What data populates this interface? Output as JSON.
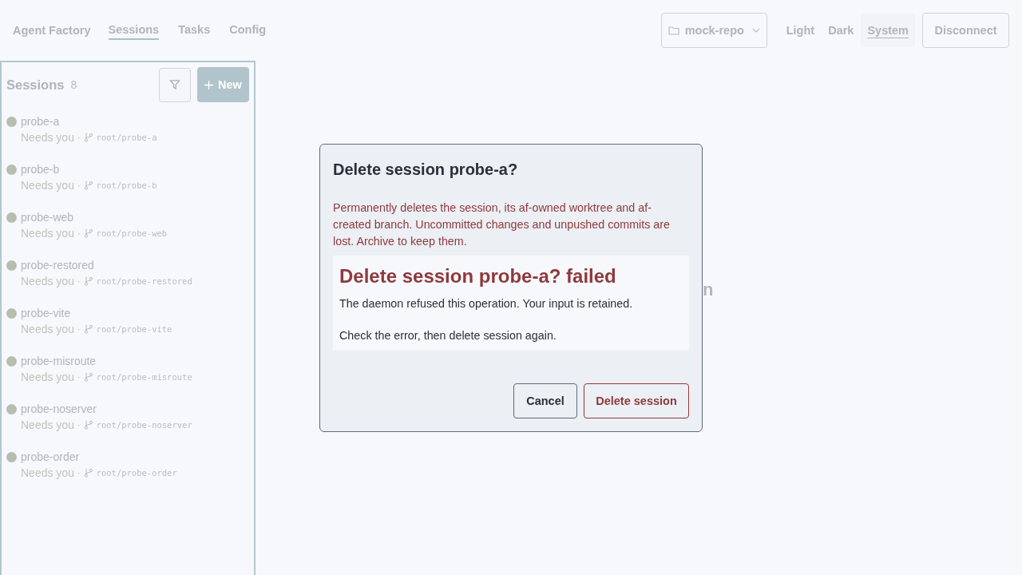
{
  "nav": {
    "brand": "Agent Factory",
    "tabs": [
      {
        "label": "Sessions",
        "selected": true
      },
      {
        "label": "Tasks",
        "selected": false
      },
      {
        "label": "Config",
        "selected": false
      }
    ]
  },
  "repo_select": {
    "value": "mock-repo"
  },
  "theme": [
    {
      "label": "Light",
      "selected": false
    },
    {
      "label": "Dark",
      "selected": false
    },
    {
      "label": "System",
      "selected": true
    }
  ],
  "disconnect_button": "Disconnect",
  "sidebar": {
    "title": "Sessions",
    "count": "8",
    "new_button": "New",
    "sessions": [
      {
        "name": "probe-a",
        "status": "Needs you",
        "separator": "·",
        "branch": "root/probe-a"
      },
      {
        "name": "probe-b",
        "status": "Needs you",
        "separator": "·",
        "branch": "root/probe-b"
      },
      {
        "name": "probe-web",
        "status": "Needs you",
        "separator": "·",
        "branch": "root/probe-web"
      },
      {
        "name": "probe-restored",
        "status": "Needs you",
        "separator": "·",
        "branch": "root/probe-restored"
      },
      {
        "name": "probe-vite",
        "status": "Needs you",
        "separator": "·",
        "branch": "root/probe-vite"
      },
      {
        "name": "probe-misroute",
        "status": "Needs you",
        "separator": "·",
        "branch": "root/probe-misroute"
      },
      {
        "name": "probe-noserver",
        "status": "Needs you",
        "separator": "·",
        "branch": "root/probe-noserver"
      },
      {
        "name": "probe-order",
        "status": "Needs you",
        "separator": "·",
        "branch": "root/probe-order"
      }
    ]
  },
  "main": {
    "covered_heading": "n"
  },
  "dialog": {
    "title": "Delete session probe-a?",
    "description": "Permanently deletes the session, its af-owned worktree and af-created branch. Uncommitted changes and unpushed commits are lost. Archive to keep them.",
    "error": {
      "title": "Delete session probe-a? failed",
      "message": "The daemon refused this operation. Your input is retained.",
      "hint": "Check the error, then delete session again."
    },
    "cancel_button": "Cancel",
    "confirm_button": "Delete session"
  }
}
